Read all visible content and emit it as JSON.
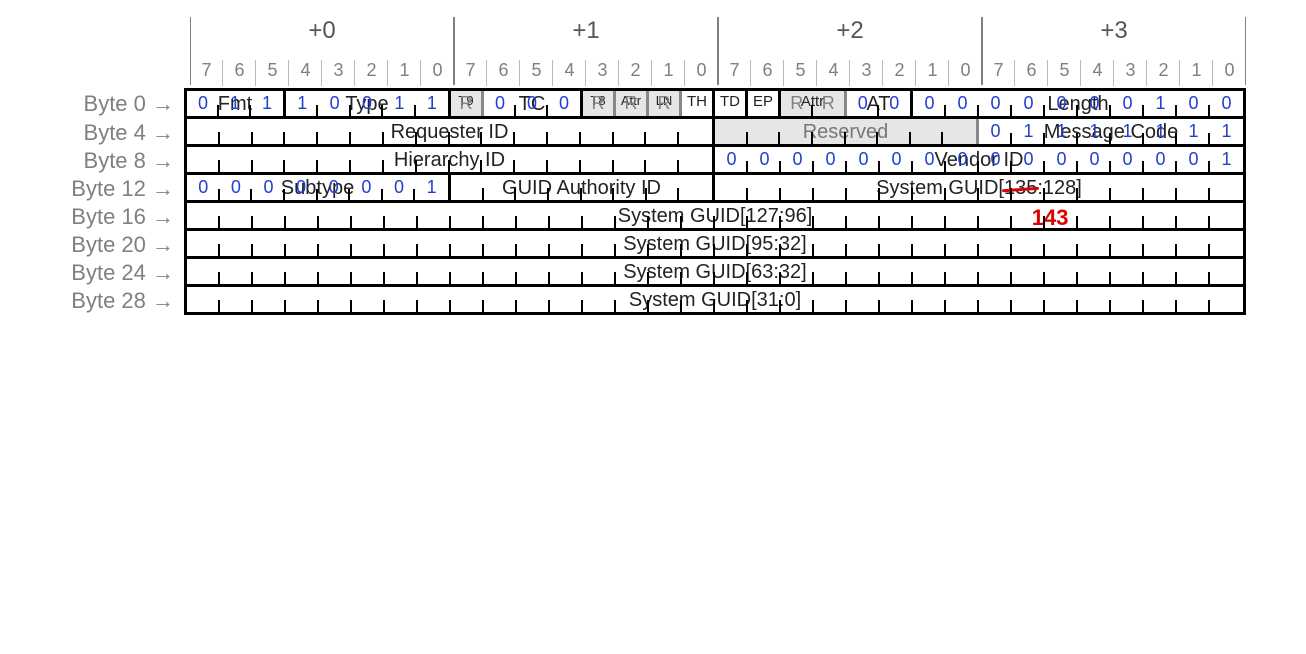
{
  "byte_headers": [
    "+0",
    "+1",
    "+2",
    "+3"
  ],
  "bit_labels": [
    7,
    6,
    5,
    4,
    3,
    2,
    1,
    0,
    7,
    6,
    5,
    4,
    3,
    2,
    1,
    0,
    7,
    6,
    5,
    4,
    3,
    2,
    1,
    0,
    7,
    6,
    5,
    4,
    3,
    2,
    1,
    0
  ],
  "row_labels": [
    "Byte 0 →",
    "Byte 4 →",
    "Byte 8 →",
    "Byte 12 →",
    "Byte 16 →",
    "Byte 20 →",
    "Byte 24 →",
    "Byte 28 →"
  ],
  "r0": {
    "fmt": {
      "name": "Fmt",
      "bits": [
        "0",
        "1",
        "1"
      ]
    },
    "type": {
      "name": "Type",
      "bits": [
        "1",
        "0",
        "0",
        "1",
        "1"
      ]
    },
    "t9": {
      "name": "T9",
      "bits": [
        "R"
      ]
    },
    "tc": {
      "name": "TC",
      "bits": [
        "0",
        "0",
        "0"
      ]
    },
    "t8": {
      "name": "T8",
      "bits": [
        "R"
      ]
    },
    "attr1": {
      "name": "Attr",
      "bits": [
        "R"
      ]
    },
    "ln": {
      "name": "LN",
      "bits": [
        "R"
      ]
    },
    "th": {
      "name": "TH"
    },
    "td": {
      "name": "TD"
    },
    "ep": {
      "name": "EP"
    },
    "attr2": {
      "name": "Attr",
      "bits": [
        "R",
        "R"
      ]
    },
    "at": {
      "name": "AT",
      "bits": [
        "0",
        "0"
      ]
    },
    "length": {
      "name": "Length",
      "bits": [
        "0",
        "0",
        "0",
        "0",
        "0",
        "0",
        "0",
        "1",
        "0",
        "0"
      ]
    }
  },
  "r4": {
    "reqid": {
      "name": "Requester ID"
    },
    "resv": {
      "name": "Reserved"
    },
    "msgcode": {
      "name": "Message Code",
      "bits": [
        "0",
        "1",
        "1",
        "1",
        "1",
        "1",
        "1",
        "1"
      ]
    }
  },
  "r8": {
    "hier": {
      "name": "Hierarchy ID"
    },
    "vendor": {
      "name": "Vendor ID",
      "bits": [
        "0",
        "0",
        "0",
        "0",
        "0",
        "0",
        "0",
        "0",
        "0",
        "0",
        "0",
        "0",
        "0",
        "0",
        "0",
        "1"
      ]
    }
  },
  "r12": {
    "subtype": {
      "name": "Subtype",
      "bits": [
        "0",
        "0",
        "0",
        "0",
        "0",
        "0",
        "0",
        "1"
      ]
    },
    "gauth": {
      "name": "GUID Authority ID"
    },
    "sguid": {
      "prefix": "System GUID[",
      "struck": "135",
      "suffix": ":128]",
      "correction": "143"
    }
  },
  "r16": {
    "name": "System GUID[127:96]"
  },
  "r20": {
    "name": "System GUID[95:32]"
  },
  "r24": {
    "name": "System GUID[63:32]"
  },
  "r28": {
    "name": "System GUID[31:0]"
  }
}
